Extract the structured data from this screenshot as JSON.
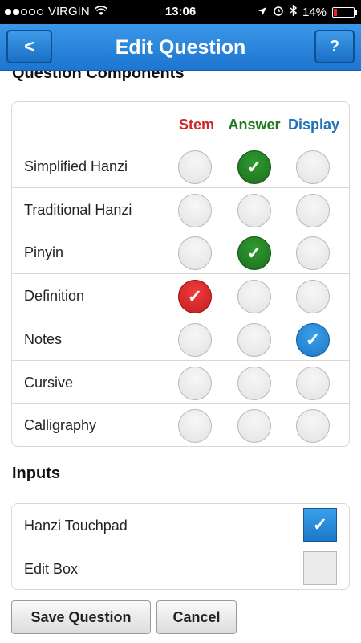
{
  "status_bar": {
    "carrier": "VIRGIN",
    "time": "13:06",
    "battery": "14%",
    "battery_level": 0.14,
    "icons": [
      "signal-dots",
      "wifi-icon",
      "location-arrow-icon",
      "alarm-icon",
      "bluetooth-icon",
      "battery-icon"
    ]
  },
  "nav": {
    "title": "Edit Question",
    "back_label": "<",
    "help_label": "?"
  },
  "components": {
    "section_title": "Question Components",
    "columns": [
      "Stem",
      "Answer",
      "Display"
    ],
    "column_colors": {
      "stem": "#cc2b2b",
      "answer": "#1f7a1f",
      "display": "#1e72b8"
    },
    "rows": [
      {
        "label": "Simplified Hanzi",
        "stem": false,
        "answer": true,
        "display": false
      },
      {
        "label": "Traditional Hanzi",
        "stem": false,
        "answer": false,
        "display": false
      },
      {
        "label": "Pinyin",
        "stem": false,
        "answer": true,
        "display": false
      },
      {
        "label": "Definition",
        "stem": true,
        "answer": false,
        "display": false
      },
      {
        "label": "Notes",
        "stem": false,
        "answer": false,
        "display": true
      },
      {
        "label": "Cursive",
        "stem": false,
        "answer": false,
        "display": false
      },
      {
        "label": "Calligraphy",
        "stem": false,
        "answer": false,
        "display": false
      }
    ],
    "check_glyph": "✓"
  },
  "inputs": {
    "section_title": "Inputs",
    "items": [
      {
        "label": "Hanzi Touchpad",
        "checked": true
      },
      {
        "label": "Edit Box",
        "checked": false
      }
    ]
  },
  "buttons": {
    "save_label": "Save Question",
    "cancel_label": "Cancel"
  }
}
